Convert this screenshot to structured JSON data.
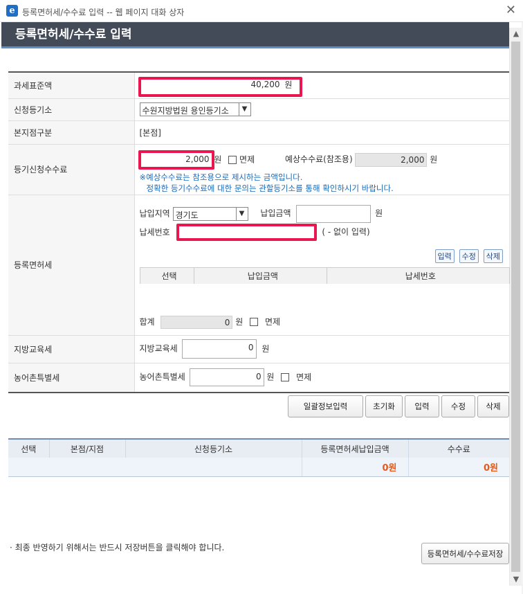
{
  "window": {
    "title": "등록면허세/수수료 입력 -- 웹 페이지 대화 상자",
    "close": "✕",
    "icon_letter": "e"
  },
  "header": {
    "title": "등록면허세/수수료 입력"
  },
  "form": {
    "tax_base": {
      "label": "과세표준액",
      "value": "40,200",
      "unit": "원"
    },
    "registry": {
      "label": "신청등기소",
      "selected": "수원지방법원 용인등기소"
    },
    "branch": {
      "label": "본지점구분",
      "value": "[본점]"
    },
    "fee": {
      "label": "등기신청수수료",
      "value": "2,000",
      "unit": "원",
      "exempt_label": "면제",
      "estimate_label": "예상수수료(참조용)",
      "estimate_value": "2,000",
      "estimate_unit": "원",
      "note1": "※예상수수료는 참조용으로 제시하는 금액입니다.",
      "note2": "정확한 등기수수료에 대한 문의는 관할등기소를 통해 확인하시기 바랍니다."
    },
    "license_tax": {
      "label": "등록면허세",
      "region_label": "납입지역",
      "region_selected": "경기도",
      "amount_label": "납입금액",
      "amount_value": "",
      "amount_unit": "원",
      "taxno_label": "납세번호",
      "taxno_value": "",
      "taxno_hint": "( - 없이 입력)",
      "buttons": {
        "input": "입력",
        "edit": "수정",
        "delete": "삭제"
      },
      "columns": [
        "선택",
        "납입금액",
        "납세번호"
      ],
      "total_label": "합계",
      "total_value": "0",
      "total_unit": "원",
      "exempt_label": "면제"
    },
    "edu_tax": {
      "label": "지방교육세",
      "field_label": "지방교육세",
      "value": "0",
      "unit": "원"
    },
    "farm_tax": {
      "label": "농어촌특별세",
      "field_label": "농어촌특별세",
      "value": "0",
      "unit": "원",
      "exempt_label": "면제"
    }
  },
  "actions": {
    "bulk": "일괄정보입력",
    "reset": "초기화",
    "input": "입력",
    "edit": "수정",
    "delete": "삭제"
  },
  "result": {
    "columns": [
      "선택",
      "본점/지점",
      "신청등기소",
      "등록면허세납입금액",
      "수수료"
    ],
    "row": {
      "tax_amount": "0원",
      "fee": "0원"
    }
  },
  "footer": {
    "note": "· 최종 반영하기 위해서는 반드시 저장버튼을 클릭해야 합니다.",
    "save": "등록면허세/수수료저장"
  },
  "colors": {
    "header_bg": "#434a58",
    "header_accent": "#5a8fc8",
    "highlight": "#e8174f",
    "amount_orange": "#e45a1a",
    "note_blue": "#1a6ab8"
  }
}
